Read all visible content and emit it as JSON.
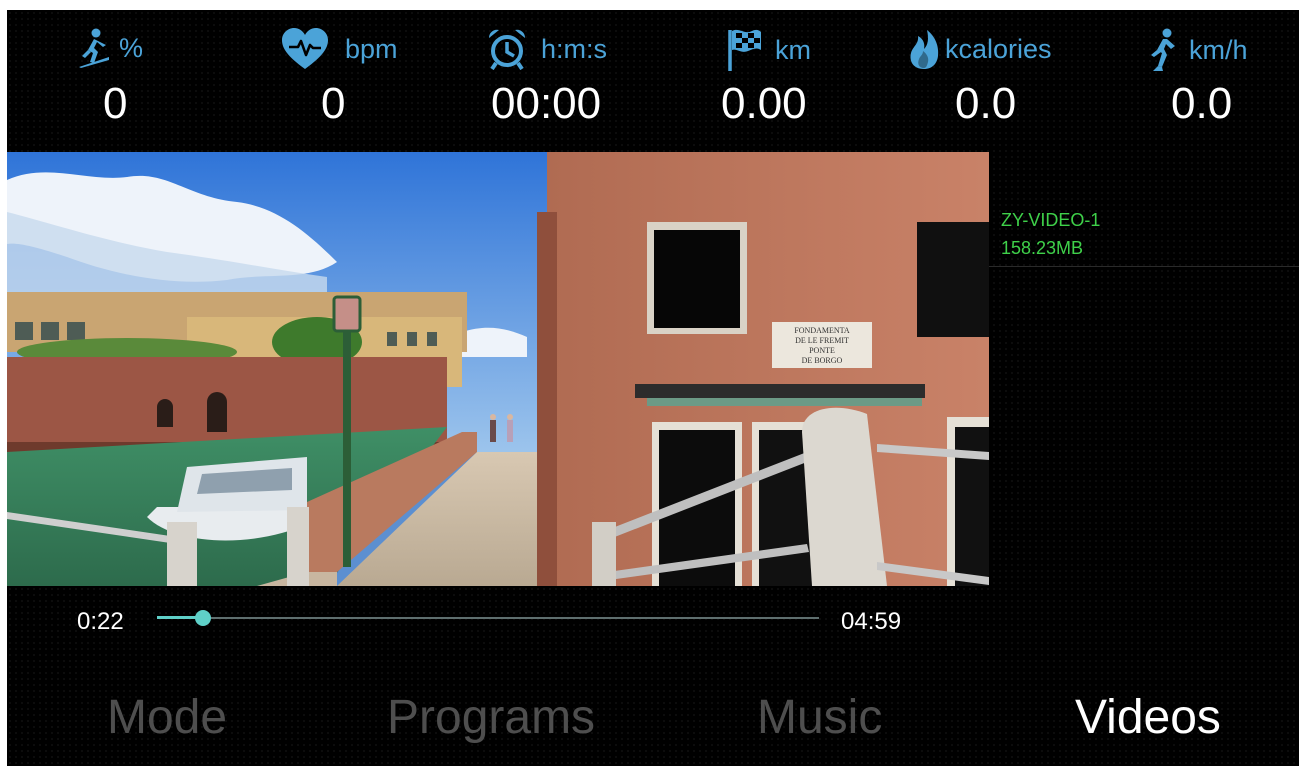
{
  "stats": [
    {
      "icon": "runner-incline-icon",
      "unit": "%",
      "value": "0"
    },
    {
      "icon": "heart-pulse-icon",
      "unit": "bpm",
      "value": "0"
    },
    {
      "icon": "alarm-clock-icon",
      "unit": "h:m:s",
      "value": "00:00"
    },
    {
      "icon": "checkered-flag-icon",
      "unit": "km",
      "value": "0.00"
    },
    {
      "icon": "flame-icon",
      "unit": "kcalories",
      "value": "0.0"
    },
    {
      "icon": "runner-icon",
      "unit": "km/h",
      "value": "0.0"
    }
  ],
  "player": {
    "current_time": "0:22",
    "total_time": "04:59",
    "progress": 0.07
  },
  "playlist": [
    {
      "name": "ZY-VIDEO-1",
      "size": "158.23MB"
    }
  ],
  "sign_text": [
    "FONDAMENTA",
    "DE LE FREMIT",
    "PONTE",
    "DE BORGO"
  ],
  "nav": {
    "tabs": [
      {
        "label": "Mode",
        "active": false
      },
      {
        "label": "Programs",
        "active": false
      },
      {
        "label": "Music",
        "active": false
      },
      {
        "label": "Videos",
        "active": true
      }
    ]
  },
  "colors": {
    "accent": "#4ba3d8",
    "progress": "#5fd0c8",
    "playlist_text": "#3fd14a",
    "inactive_tab": "#4e4e4e"
  }
}
